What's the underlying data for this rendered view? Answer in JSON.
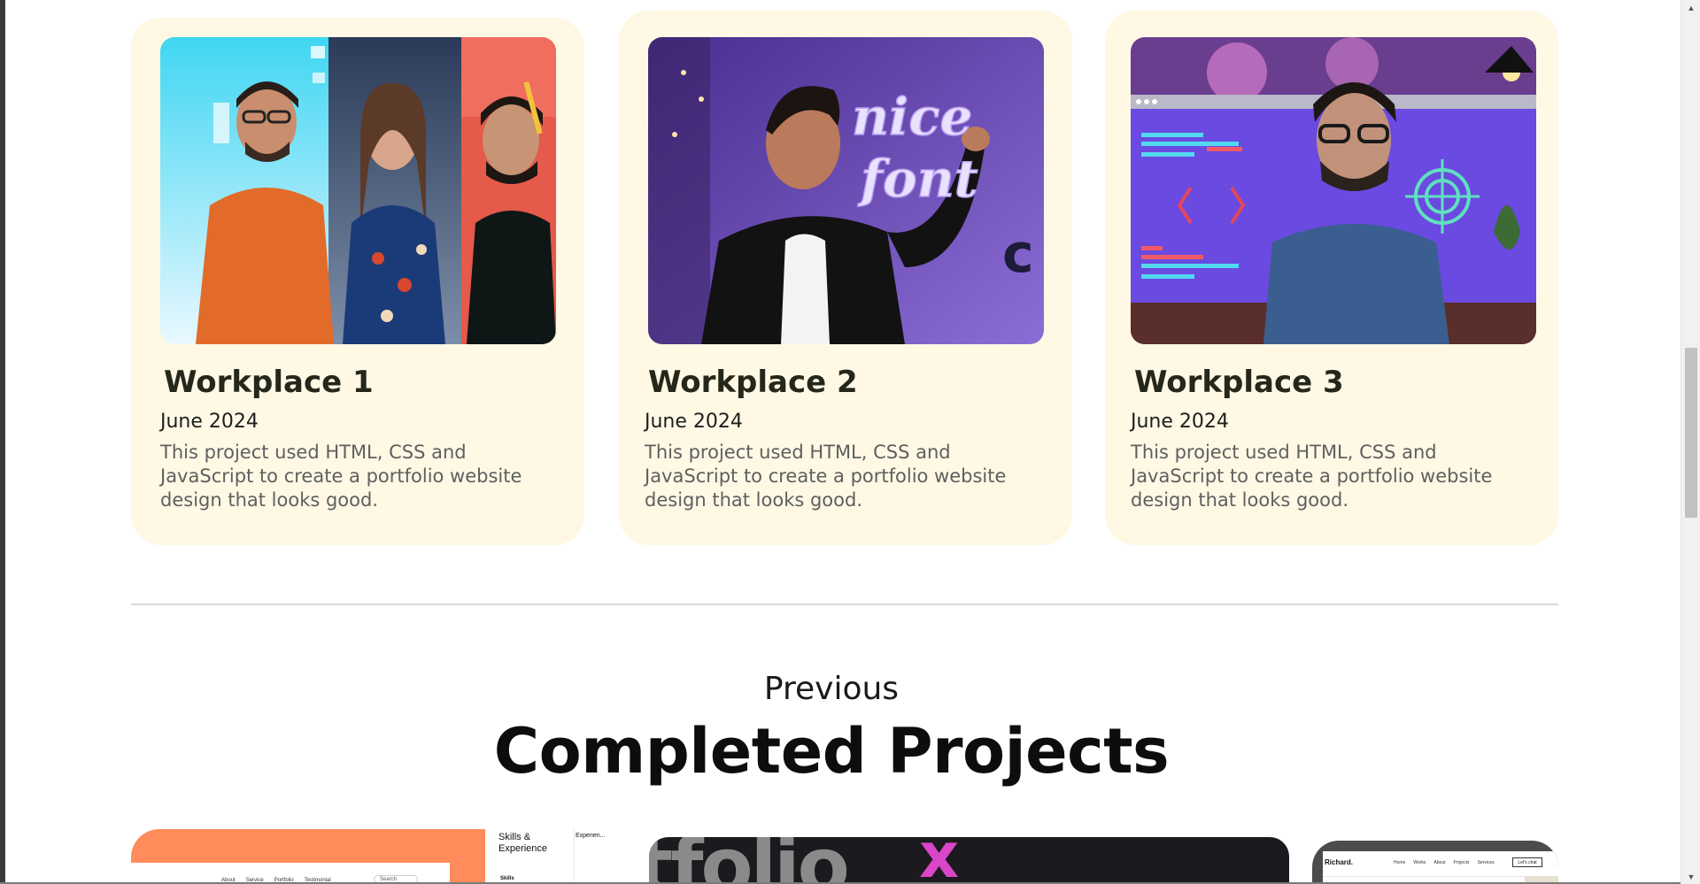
{
  "workplaces": [
    {
      "title": "Workplace 1",
      "date": "June 2024",
      "description": "This project used HTML, CSS and JavaScript to create a portfolio website design that looks good.",
      "image_alt": "three people collage"
    },
    {
      "title": "Workplace 2",
      "date": "June 2024",
      "description": "This project used HTML, CSS and JavaScript to create a portfolio website design that looks good.",
      "image_alt": "man writing nice font"
    },
    {
      "title": "Workplace 3",
      "date": "June 2024",
      "description": "This project used HTML, CSS and JavaScript to create a portfolio website design that looks good.",
      "image_alt": "man in front of code screen"
    }
  ],
  "projects_section": {
    "eyebrow": "Previous",
    "title": "Completed Projects"
  },
  "project_previews": {
    "p1": {
      "nav": [
        "About",
        "Service",
        "Portfolio",
        "Testimonial"
      ],
      "search": "Search",
      "panel_title": "Skills & Experience",
      "panel_sub": "Skills",
      "side_title": "Experien..."
    },
    "p2": {
      "big_text": "tfolio",
      "mark": "x"
    },
    "p3": {
      "brand": "Richard.",
      "nav": [
        "Home",
        "Works",
        "About",
        "Projects",
        "Services"
      ],
      "cta": "Let's chat"
    }
  },
  "colors": {
    "card_bg": "#fef8e4",
    "title": "#25271b",
    "muted": "#5f5f5f",
    "divider": "#d8d8d8",
    "accent_orange": "#ff8c5a",
    "accent_pink": "#d946c9"
  },
  "scrollbar": {
    "position_fraction": 0.4
  }
}
